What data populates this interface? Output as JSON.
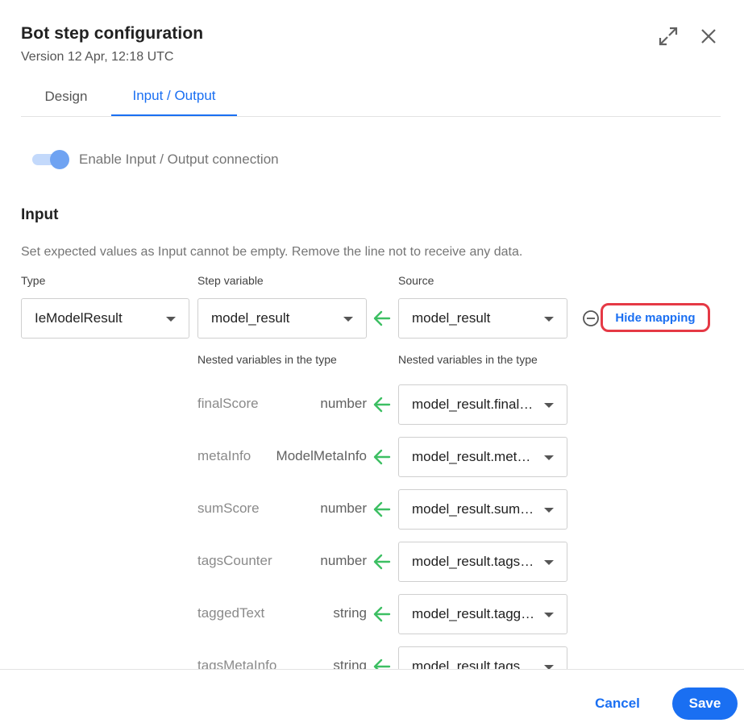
{
  "dialog": {
    "title": "Bot step configuration",
    "subtitle": "Version 12 Apr, 12:18 UTC"
  },
  "tabs": [
    {
      "label": "Design",
      "active": false
    },
    {
      "label": "Input / Output",
      "active": true
    }
  ],
  "toggle": {
    "label": "Enable Input / Output connection",
    "enabled": true
  },
  "input": {
    "title": "Input",
    "hint": "Set expected values as Input cannot be empty. Remove the line not to receive any data.",
    "columns": {
      "type": "Type",
      "step_variable": "Step variable",
      "source": "Source"
    },
    "type_value": "IeModelResult",
    "step_variable_value": "model_result",
    "source_value": "model_result",
    "hide_mapping_label": "Hide mapping",
    "nested_label_left": "Nested variables in the type",
    "nested_label_right": "Nested variables in the type",
    "nested": [
      {
        "name": "finalScore",
        "type": "number",
        "source": "model_result.finalScore"
      },
      {
        "name": "metaInfo",
        "type": "ModelMetaInfo",
        "source": "model_result.metaInfo"
      },
      {
        "name": "sumScore",
        "type": "number",
        "source": "model_result.sumScore"
      },
      {
        "name": "tagsCounter",
        "type": "number",
        "source": "model_result.tagsCounter"
      },
      {
        "name": "taggedText",
        "type": "string",
        "source": "model_result.taggedText"
      },
      {
        "name": "tagsMetaInfo",
        "type": "string",
        "source": "model_result.tagsMetaInfo"
      }
    ]
  },
  "footer": {
    "cancel_label": "Cancel",
    "save_label": "Save"
  },
  "colors": {
    "accent": "#1a6ff2",
    "arrow": "#3dbf63",
    "highlight": "#e53945"
  }
}
